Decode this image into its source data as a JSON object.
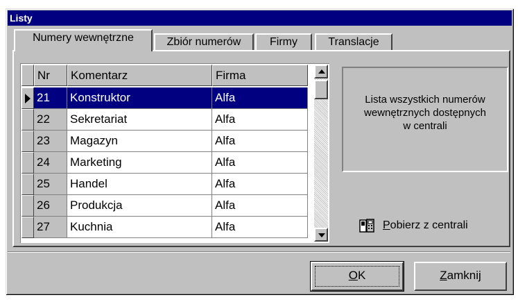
{
  "window": {
    "title": "Listy"
  },
  "tabs": [
    {
      "label": "Numery wewnętrzne",
      "active": true
    },
    {
      "label": "Zbiór numerów",
      "active": false
    },
    {
      "label": "Firmy",
      "active": false
    },
    {
      "label": "Translacje",
      "active": false
    }
  ],
  "grid": {
    "columns": [
      "Nr",
      "Komentarz",
      "Firma"
    ],
    "selected_row": 0,
    "rows": [
      {
        "nr": "21",
        "komentarz": "Konstruktor",
        "firma": "Alfa"
      },
      {
        "nr": "22",
        "komentarz": "Sekretariat",
        "firma": "Alfa"
      },
      {
        "nr": "23",
        "komentarz": "Magazyn",
        "firma": "Alfa"
      },
      {
        "nr": "24",
        "komentarz": "Marketing",
        "firma": "Alfa"
      },
      {
        "nr": "25",
        "komentarz": "Handel",
        "firma": "Alfa"
      },
      {
        "nr": "26",
        "komentarz": "Produkcja",
        "firma": "Alfa"
      },
      {
        "nr": "27",
        "komentarz": "Kuchnia",
        "firma": "Alfa"
      }
    ]
  },
  "info": {
    "line1": "Lista wszystkich numerów",
    "line2": "wewnętrznych dostępnych",
    "line3": "w centrali"
  },
  "fetch": {
    "accel": "P",
    "rest": "obierz z centrali",
    "icon": "phone-icon"
  },
  "buttons": {
    "ok": {
      "accel": "O",
      "rest": "K"
    },
    "close": {
      "accel": "Z",
      "rest": "amknij"
    }
  },
  "colors": {
    "titlebar": "#000080",
    "selection": "#000080",
    "face": "#c0c0c0"
  }
}
